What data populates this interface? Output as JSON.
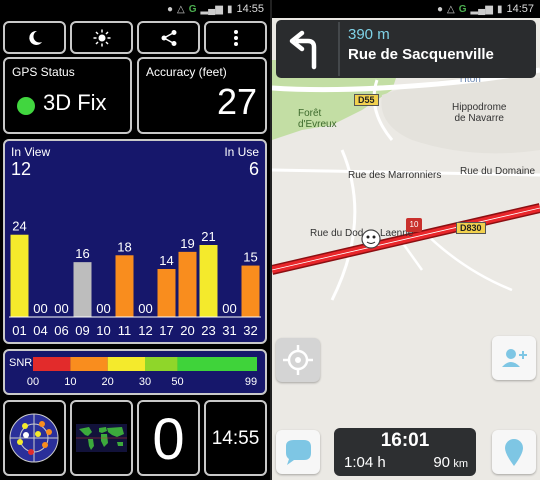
{
  "left": {
    "status_time": "14:55",
    "status_network": "G",
    "toolbar": {
      "night_icon": "moon-icon",
      "day_icon": "sun-icon",
      "share_icon": "share-icon",
      "menu_icon": "overflow-menu-icon"
    },
    "gps_status": {
      "label": "GPS Status",
      "value": "3D Fix",
      "dot_color": "#41d63f"
    },
    "accuracy": {
      "label": "Accuracy (feet)",
      "value": "27"
    },
    "satellites": {
      "in_view_label": "In View",
      "in_view": "12",
      "in_use_label": "In Use",
      "in_use": "6"
    },
    "chart_data": {
      "type": "bar",
      "categories": [
        "01",
        "04",
        "06",
        "09",
        "10",
        "11",
        "12",
        "17",
        "20",
        "23",
        "31",
        "32"
      ],
      "values": [
        24,
        0,
        0,
        16,
        0,
        18,
        0,
        14,
        19,
        21,
        0,
        15
      ],
      "value_labels": [
        "24",
        "00",
        "00",
        "16",
        "00",
        "18",
        "00",
        "14",
        "19",
        "21",
        "00",
        "15"
      ],
      "colors": [
        "#f4ea2c",
        "#f4ea2c",
        "#f4ea2c",
        "#bdbdbd",
        "#f4ea2c",
        "#f98d1e",
        "#f4ea2c",
        "#f98d1e",
        "#f98d1e",
        "#f4ea2c",
        "#f4ea2c",
        "#f98d1e"
      ],
      "ylim": [
        0,
        40
      ]
    },
    "snr": {
      "label": "SNR",
      "ticks": [
        "00",
        "10",
        "20",
        "30",
        "50",
        "99"
      ],
      "segments": [
        {
          "color": "#e22b2b",
          "from": 0,
          "to": 10
        },
        {
          "color": "#f98d1e",
          "from": 10,
          "to": 20
        },
        {
          "color": "#f4ea2c",
          "from": 20,
          "to": 30
        },
        {
          "color": "#8fd62a",
          "from": 30,
          "to": 50
        },
        {
          "color": "#3fd33a",
          "from": 50,
          "to": 99
        }
      ]
    },
    "bottom": {
      "radar_icon": "sky-radar-icon",
      "map_icon": "world-map-icon",
      "sat_count": "0",
      "clock": "14:55"
    }
  },
  "right": {
    "status_time": "14:57",
    "status_network": "G",
    "nav": {
      "turn_icon": "turn-left-arrow-icon",
      "distance": "390 m",
      "street": "Rue de Sacquenville"
    },
    "map_labels": {
      "lton": "l'Iton",
      "d55": "D55",
      "foret": "Forêt\nd'Evreux",
      "hippodrome": "Hippodrome\nde Navarre",
      "marronniers": "Rue des Marronniers",
      "domaine": "Rue du Domaine",
      "dod": "Rue du Dod",
      "laenne": "Laenne",
      "d830": "D830",
      "speed_sign": "10"
    },
    "controls": {
      "locate_icon": "crosshair-locate-icon",
      "add_user_icon": "add-user-icon",
      "chat_icon": "chat-bubble-icon",
      "pin_icon": "location-pin-icon"
    },
    "eta": {
      "time": "16:01",
      "duration": "1:04 h",
      "distance": "90",
      "distance_unit": "km"
    }
  }
}
